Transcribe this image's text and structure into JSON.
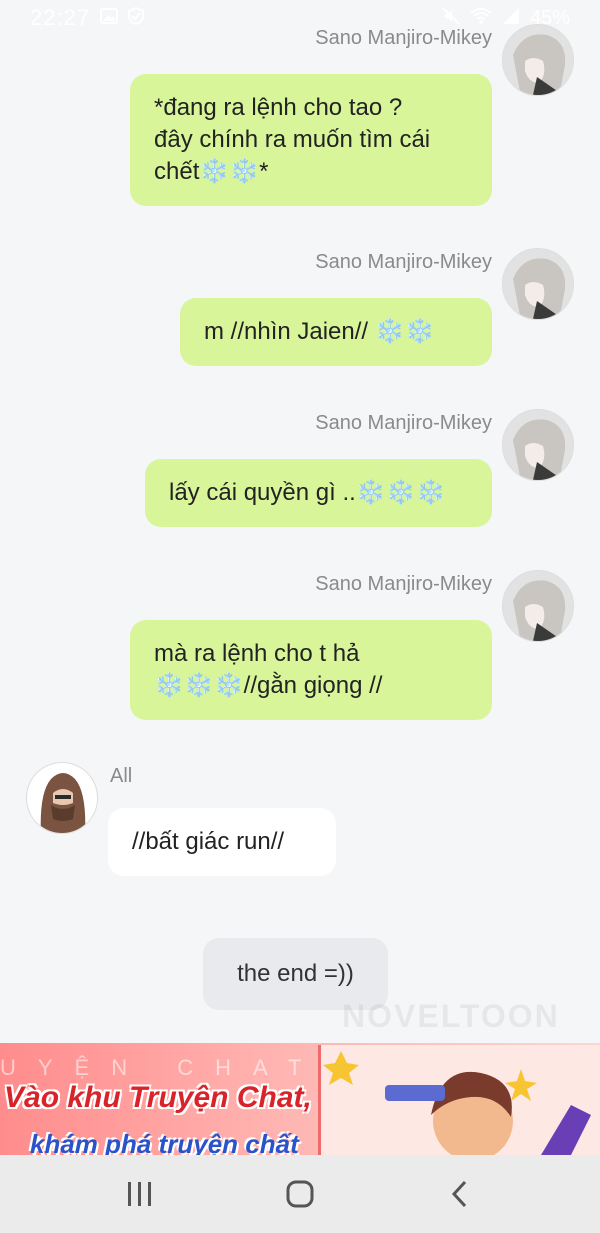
{
  "status_bar": {
    "time": "22:27",
    "battery": "45%"
  },
  "messages": [
    {
      "sender": "Sano Manjiro-Mikey",
      "lines": [
        "*đang ra lệnh cho tao ?",
        "đây chính ra muốn tìm cái",
        "chết❄️❄️*"
      ]
    },
    {
      "sender": "Sano Manjiro-Mikey",
      "lines": [
        "m //nhìn Jaien// ❄️❄️"
      ]
    },
    {
      "sender": "Sano Manjiro-Mikey",
      "lines": [
        "lấy cái quyền gì ..❄️❄️❄️"
      ]
    },
    {
      "sender": "Sano Manjiro-Mikey",
      "lines": [
        "mà ra lệnh cho t hả",
        "❄️❄️❄️//gằn giọng //"
      ]
    },
    {
      "sender": "All",
      "lines": [
        "//bất giác run//"
      ]
    }
  ],
  "end_text": "the end =))",
  "watermark": "NOVELTOON",
  "banner": {
    "bg_text": "UYỆN CHAT . KHÁM PHÁ",
    "cta_line1": "Vào khu Truyện Chat,",
    "cta_line2": "khám phá truyện chất"
  },
  "colors": {
    "green_bubble": "#d8f59a",
    "white_bubble": "#ffffff",
    "gray_bubble": "#e9eaed",
    "background": "#f5f6f8"
  },
  "icons": {
    "status_left": [
      "gallery-icon",
      "shield-check-icon"
    ],
    "status_right": [
      "mute-icon",
      "wifi-icon",
      "signal-icon",
      "battery-icon"
    ],
    "nav": [
      "recent-apps-icon",
      "home-icon",
      "back-icon"
    ]
  }
}
